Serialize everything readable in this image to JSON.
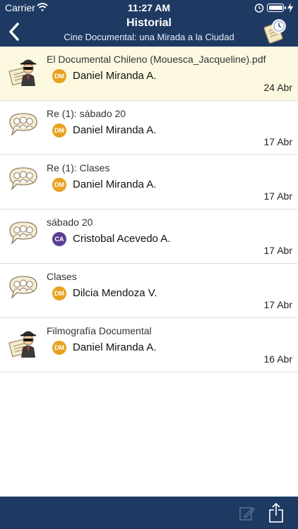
{
  "status_bar": {
    "carrier": "Carrier",
    "time": "11:27 AM"
  },
  "header": {
    "title": "Historial",
    "subtitle": "Cine Documental: una Mirada a la Ciudad",
    "back_icon": "chevron-left-icon",
    "history_icon": "clock-clipboard-icon",
    "background": "#1e3a63"
  },
  "items": [
    {
      "title": "El Documental Chileno (Mouesca_Jacqueline).pdf",
      "avatar": "DM",
      "avatar_color": "#e8a21f",
      "sender": "Daniel Miranda A.",
      "date": "24 Abr",
      "icon": "spy-document-icon",
      "highlighted": true
    },
    {
      "title": "Re (1): sábado 20",
      "avatar": "DM",
      "avatar_color": "#e8a21f",
      "sender": "Daniel Miranda A.",
      "date": "17 Abr",
      "icon": "group-chat-icon",
      "highlighted": false
    },
    {
      "title": "Re (1): Clases",
      "avatar": "DM",
      "avatar_color": "#e8a21f",
      "sender": "Daniel Miranda A.",
      "date": "17 Abr",
      "icon": "group-chat-icon",
      "highlighted": false
    },
    {
      "title": "sábado 20",
      "avatar": "CA",
      "avatar_color": "#5b3e91",
      "sender": "Cristobal Acevedo A.",
      "date": "17 Abr",
      "icon": "group-chat-icon",
      "highlighted": false
    },
    {
      "title": "Clases",
      "avatar": "DM",
      "avatar_color": "#e8a21f",
      "sender": "Dilcia Mendoza V.",
      "date": "17 Abr",
      "icon": "group-chat-icon",
      "highlighted": false
    },
    {
      "title": "Filmografía Documental",
      "avatar": "DM",
      "avatar_color": "#e8a21f",
      "sender": "Daniel Miranda A.",
      "date": "16 Abr",
      "icon": "spy-document-icon",
      "highlighted": false
    }
  ],
  "footer": {
    "compose_icon": "compose-icon",
    "share_icon": "share-icon"
  }
}
